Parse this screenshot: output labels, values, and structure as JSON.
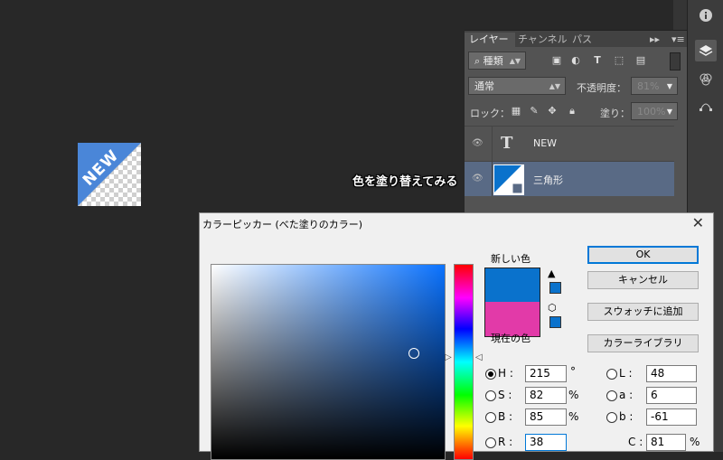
{
  "canvas": {
    "art_text": "NEW"
  },
  "layers_panel": {
    "tabs": [
      "レイヤー",
      "チャンネル",
      "パス"
    ],
    "filter_label": "種類",
    "blend_mode": "通常",
    "opacity_label": "不透明度：",
    "opacity_value": "81%",
    "lock_label": "ロック：",
    "fill_label": "塗り：",
    "fill_value": "100%",
    "layers": [
      {
        "name": "NEW",
        "type": "text"
      },
      {
        "name": "三角形",
        "type": "shape",
        "selected": true
      }
    ]
  },
  "annotation": "色を塗り替えてみる",
  "dialog": {
    "title": "カラーピッカー (べた塗りのカラー)",
    "new_color_label": "新しい色",
    "current_color_label": "現在の色",
    "new_color": "#0a72cc",
    "current_color": "#e23aa8",
    "buttons": {
      "ok": "OK",
      "cancel": "キャンセル",
      "add_swatch": "スウォッチに追加",
      "libraries": "カラーライブラリ"
    },
    "hsb": [
      {
        "label": "H :",
        "value": "215",
        "unit": "°"
      },
      {
        "label": "S :",
        "value": "82",
        "unit": "%"
      },
      {
        "label": "B :",
        "value": "85",
        "unit": "%"
      }
    ],
    "rgb_r": {
      "label": "R :",
      "value": "38"
    },
    "lab": [
      {
        "label": "L :",
        "value": "48"
      },
      {
        "label": "a :",
        "value": "6"
      },
      {
        "label": "b :",
        "value": "-61"
      }
    ],
    "cmyk_c": {
      "label": "C :",
      "value": "81",
      "unit": "%"
    }
  }
}
